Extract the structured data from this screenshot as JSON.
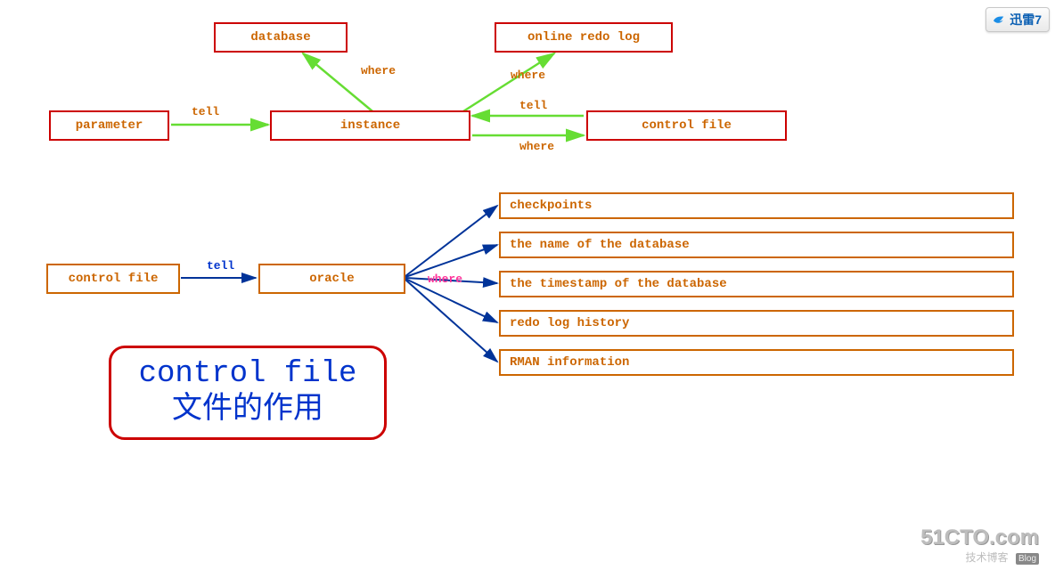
{
  "top": {
    "database": "database",
    "online_redo_log": "online redo log",
    "parameter": "parameter",
    "instance": "instance",
    "control_file": "control file"
  },
  "top_labels": {
    "where1": "where",
    "where2": "where",
    "where3": "where",
    "tell1": "tell",
    "tell2": "tell"
  },
  "bottom": {
    "control_file": "control file",
    "oracle": "oracle",
    "tell": "tell",
    "where": "where"
  },
  "info": {
    "i1": "checkpoints",
    "i2": "the name of the database",
    "i3": "the timestamp of the database",
    "i4": "redo log history",
    "i5": "RMAN information"
  },
  "title": {
    "line1": "control file",
    "line2": "文件的作用"
  },
  "badge": {
    "text": "迅雷7"
  },
  "watermark": {
    "main": "51CTO.com",
    "sub": "技术博客",
    "blog": "Blog"
  }
}
